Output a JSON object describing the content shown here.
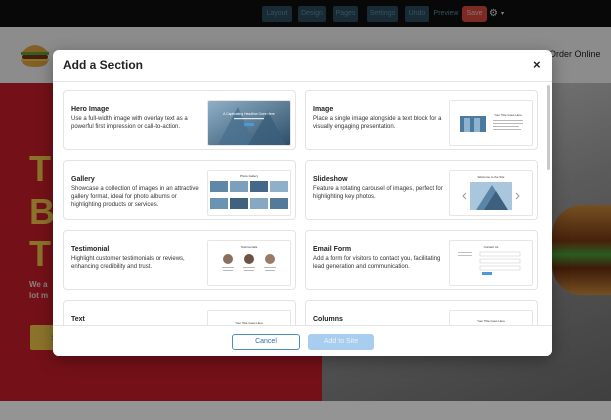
{
  "topbar": {
    "buttons": [
      {
        "label": "Layout"
      },
      {
        "label": "Design"
      },
      {
        "label": "Pages"
      },
      {
        "label": "Settings"
      },
      {
        "label": "Undo"
      }
    ],
    "preview_label": "Preview",
    "save_label": "Save",
    "gear_glyph": "⚙",
    "gear_caret": "▾"
  },
  "background_site": {
    "nav_order_label": "Order Online",
    "hero_letters": [
      "T",
      "B",
      "T"
    ],
    "hero_small_lines": [
      "We a",
      "lot m"
    ],
    "cta_letter": "S"
  },
  "modal": {
    "title": "Add a Section",
    "close_glyph": "×",
    "sections": [
      {
        "title": "Hero Image",
        "description": "Use a full-width image with overlay text as a powerful first impression or call-to-action.",
        "thumb": "hero-image-preview"
      },
      {
        "title": "Image",
        "description": "Place a single image alongside a text block for a visually engaging presentation.",
        "thumb": "image-preview"
      },
      {
        "title": "Gallery",
        "description": "Showcase a collection of images in an attractive gallery format, ideal for photo albums or highlighting products or services.",
        "thumb": "gallery-preview"
      },
      {
        "title": "Slideshow",
        "description": "Feature a rotating carousel of images, perfect for highlighting key photos.",
        "thumb": "slideshow-preview"
      },
      {
        "title": "Testimonial",
        "description": "Highlight customer testimonials or reviews, enhancing credibility and trust.",
        "thumb": "testimonial-preview"
      },
      {
        "title": "Email Form",
        "description": "Add a form for visitors to contact you, facilitating lead generation and communication.",
        "thumb": "email-form-preview"
      },
      {
        "title": "Text",
        "description": "",
        "thumb": "text-preview"
      },
      {
        "title": "Columns",
        "description": "",
        "thumb": "columns-preview"
      }
    ],
    "thumb_texts": {
      "hero_headline": "A Captivating Headline Goes Here",
      "image_headline": "Your Title Goes Here",
      "gallery_headline": "Photo Gallery",
      "slideshow_headline": "Welcome to the Site",
      "testimonial_headline": "Testimonials",
      "email_headline": "Contact Us",
      "text_headline": "Your Title Goes Here",
      "columns_headline": "Your Title Goes Here"
    },
    "cancel_label": "Cancel",
    "add_label": "Add to Site"
  },
  "colors": {
    "accent": "#4b8ec6",
    "add_disabled": "#a8cdee",
    "hero_red": "#c91e2a",
    "hero_yellow": "#f2c64a",
    "save_red": "#d8483e"
  }
}
